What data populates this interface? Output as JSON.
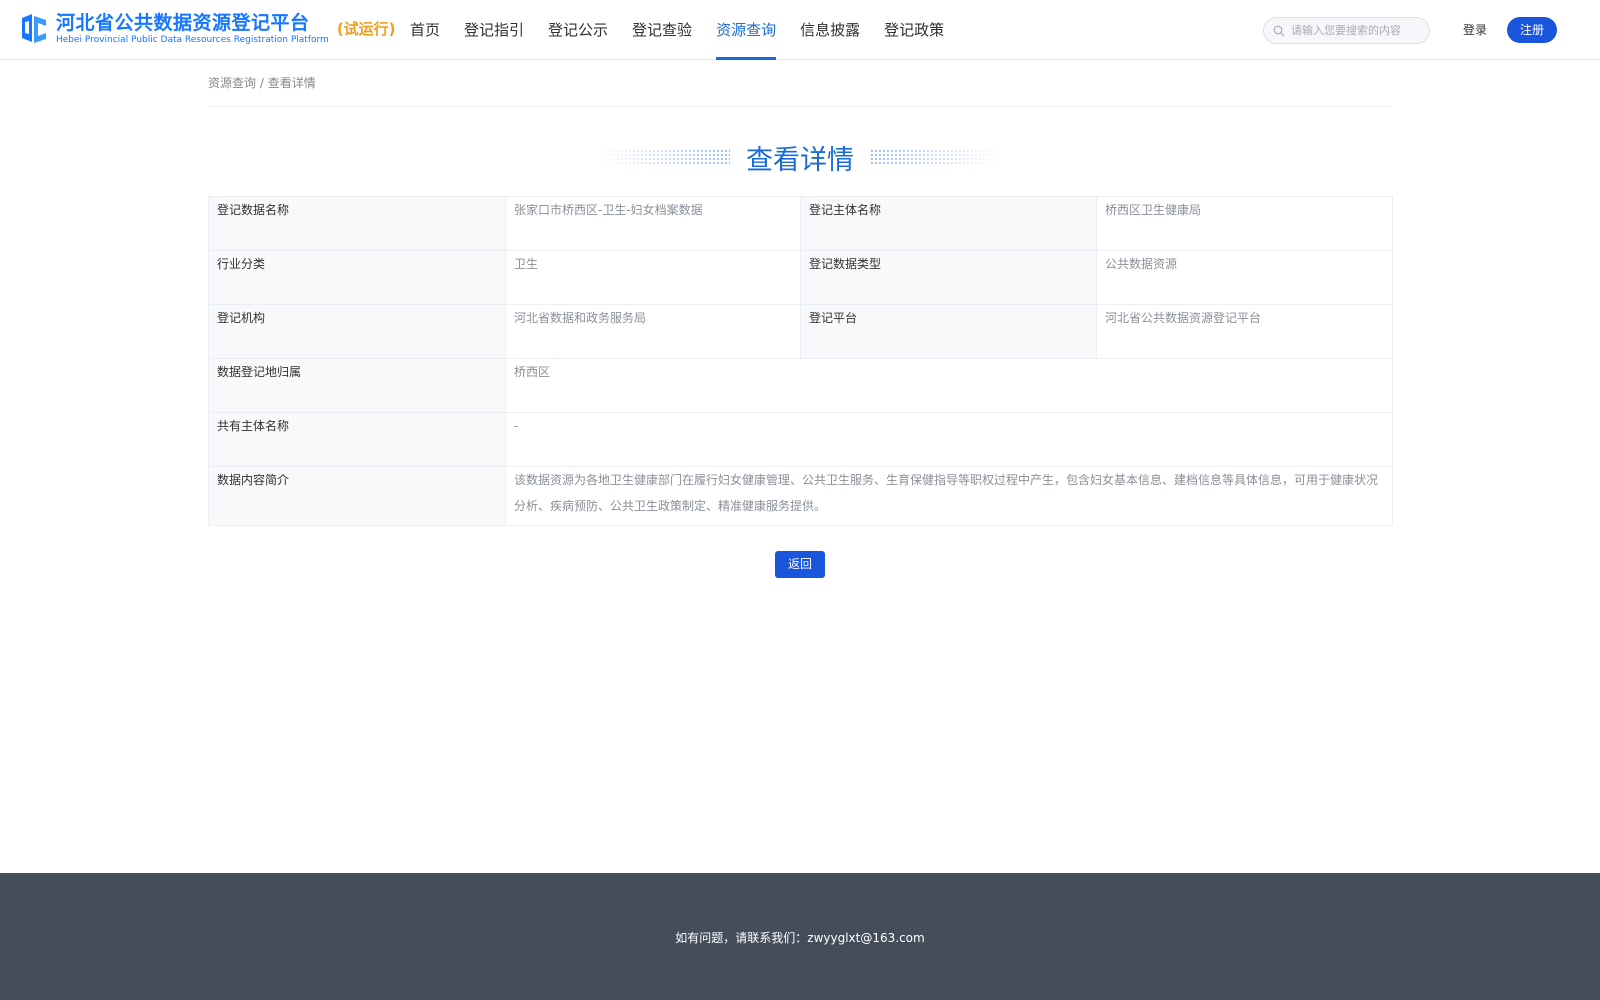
{
  "header": {
    "logo_cn": "河北省公共数据资源登记平台",
    "logo_en": "Hebei Provincial Public Data Resources Registration Platform",
    "logo_trial": "(试运行)",
    "nav": [
      {
        "label": "首页"
      },
      {
        "label": "登记指引"
      },
      {
        "label": "登记公示"
      },
      {
        "label": "登记查验"
      },
      {
        "label": "资源查询",
        "active": true
      },
      {
        "label": "信息披露"
      },
      {
        "label": "登记政策"
      }
    ],
    "search_placeholder": "请输入您要搜索的内容",
    "login_label": "登录",
    "register_label": "注册",
    "accent_color": "#1a6bd8"
  },
  "breadcrumb": {
    "parent": "资源查询",
    "separator": " / ",
    "current": "查看详情"
  },
  "title": "查看详情",
  "details": {
    "row1": {
      "label_a": "登记数据名称",
      "value_a": "张家口市桥西区-卫生-妇女档案数据",
      "label_b": "登记主体名称",
      "value_b": "桥西区卫生健康局"
    },
    "row2": {
      "label_a": "行业分类",
      "value_a": "卫生",
      "label_b": "登记数据类型",
      "value_b": "公共数据资源"
    },
    "row3": {
      "label_a": "登记机构",
      "value_a": "河北省数据和政务服务局",
      "label_b": "登记平台",
      "value_b": "河北省公共数据资源登记平台"
    },
    "row4": {
      "label": "数据登记地归属",
      "value": "桥西区"
    },
    "row5": {
      "label": "共有主体名称",
      "value": "-"
    },
    "row6": {
      "label": "数据内容简介",
      "value": "该数据资源为各地卫生健康部门在履行妇女健康管理、公共卫生服务、生育保健指导等职权过程中产生，包含妇女基本信息、建档信息等具体信息，可用于健康状况分析、疾病预防、公共卫生政策制定、精准健康服务提供。"
    }
  },
  "back_label": "返回",
  "footer": {
    "contact": "如有问题，请联系我们：zwyyglxt@163.com"
  }
}
